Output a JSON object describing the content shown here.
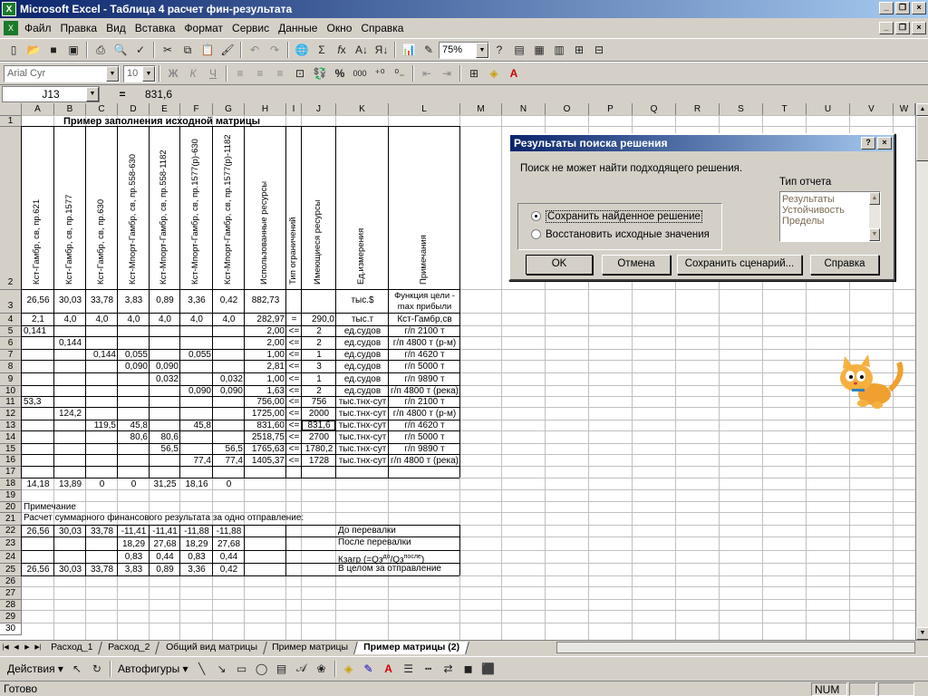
{
  "window": {
    "title": "Microsoft Excel - Таблица 4 расчет фин-результата"
  },
  "menu": [
    "Файл",
    "Правка",
    "Вид",
    "Вставка",
    "Формат",
    "Сервис",
    "Данные",
    "Окно",
    "Справка"
  ],
  "toolbar": {
    "zoom": "75%"
  },
  "format": {
    "font": "Arial Cyr",
    "size": "10"
  },
  "formula": {
    "cell": "J13",
    "eq": "=",
    "value": "831,6"
  },
  "columns": [
    "A",
    "B",
    "C",
    "D",
    "E",
    "F",
    "G",
    "H",
    "I",
    "J",
    "K",
    "L",
    "M",
    "N",
    "O",
    "P",
    "Q",
    "R",
    "S",
    "T",
    "U",
    "V",
    "W"
  ],
  "rows": [
    "1",
    "2",
    "3",
    "4",
    "5",
    "6",
    "7",
    "8",
    "9",
    "10",
    "11",
    "12",
    "13",
    "14",
    "15",
    "16",
    "17",
    "18",
    "19",
    "20",
    "21",
    "22",
    "23",
    "24",
    "25",
    "26",
    "27",
    "28",
    "29",
    "30"
  ],
  "sheet": {
    "title": "Пример заполнения исходной матрицы",
    "headers": [
      "Кст-Гамбр, св, пр.621",
      "Кст-Гамбр, св, пр.1577",
      "Кст-Гамбр, св, пр.630",
      "Кст-Мпорт-Гамбр, св, пр.558-630",
      "Кст-Мпорт-Гамбр, св, пр.558-1182",
      "Кст-Мпорт-Гамбр, св, пр.1577(р)-630",
      "Кст-Мпорт-Гамбр, св, пр.1577(р)-1182",
      "Использованные ресурсы",
      "Тип ограничений",
      "Имеющиеся ресурсы",
      "Ед.измерения",
      "Примечания"
    ],
    "r3": [
      "26,56",
      "30,03",
      "33,78",
      "3,83",
      "0,89",
      "3,36",
      "0,42",
      "882,73",
      "",
      "",
      "тыс.$",
      "Функция цели - max прибыли"
    ],
    "r4": [
      "2,1",
      "4,0",
      "4,0",
      "4,0",
      "4,0",
      "4,0",
      "4,0",
      "282,97",
      "=",
      "290,0",
      "тыс.т",
      "Кст-Гамбр,св"
    ],
    "r5": [
      "0,141",
      "",
      "",
      "",
      "",
      "",
      "",
      "2,00",
      "<=",
      "2",
      "ед.судов",
      "г/п 2100 т"
    ],
    "r6": [
      "",
      "0,144",
      "",
      "",
      "",
      "",
      "",
      "2,00",
      "<=",
      "2",
      "ед.судов",
      "г/п 4800 т (р-м)"
    ],
    "r7": [
      "",
      "",
      "0,144",
      "0,055",
      "",
      "0,055",
      "",
      "1,00",
      "<=",
      "1",
      "ед.судов",
      "г/п 4620 т"
    ],
    "r8": [
      "",
      "",
      "",
      "0,090",
      "0,090",
      "",
      "",
      "2,81",
      "<=",
      "3",
      "ед.судов",
      "г/п 5000 т"
    ],
    "r9": [
      "",
      "",
      "",
      "",
      "0,032",
      "",
      "0,032",
      "1,00",
      "<=",
      "1",
      "ед.судов",
      "г/п 9890 т"
    ],
    "r10": [
      "",
      "",
      "",
      "",
      "",
      "0,090",
      "0,090",
      "1,63",
      "<=",
      "2",
      "ед.судов",
      "г/п 4800 т (река)"
    ],
    "r11": [
      "53,3",
      "",
      "",
      "",
      "",
      "",
      "",
      "756,00",
      "<=",
      "756",
      "тыс.тнх-сут",
      "г/п 2100 т"
    ],
    "r12": [
      "",
      "124,2",
      "",
      "",
      "",
      "",
      "",
      "1725,00",
      "<=",
      "2000",
      "тыс.тнх-сут",
      "г/п 4800 т (р-м)"
    ],
    "r13": [
      "",
      "",
      "119,5",
      "45,8",
      "",
      "45,8",
      "",
      "831,60",
      "<=",
      "831,6",
      "тыс.тнх-сут",
      "г/п 4620 т"
    ],
    "r14": [
      "",
      "",
      "",
      "80,6",
      "80,6",
      "",
      "",
      "2518,75",
      "<=",
      "2700",
      "тыс.тнх-сут",
      "г/п 5000 т"
    ],
    "r15": [
      "",
      "",
      "",
      "",
      "56,5",
      "",
      "56,5",
      "1765,63",
      "<=",
      "1780,2",
      "тыс.тнх-сут",
      "г/п 9890 т"
    ],
    "r16": [
      "",
      "",
      "",
      "",
      "",
      "77,4",
      "77,4",
      "1405,37",
      "<=",
      "1728",
      "тыс.тнх-сут",
      "г/п 4800 т (река)"
    ],
    "r18": [
      "14,18",
      "13,89",
      "0",
      "0",
      "31,25",
      "18,16",
      "0"
    ],
    "r20": "Примечание",
    "r21": "Расчет суммарного финансового результата за одно отправление:",
    "r22": [
      "26,56",
      "30,03",
      "33,78",
      "-11,41",
      "-11,41",
      "-11,88",
      "-11,88"
    ],
    "r22k": "До перевалки",
    "r23": [
      "",
      "",
      "",
      "18,29",
      "27,68",
      "18,29",
      "27,68"
    ],
    "r23k": "После перевалки",
    "r24": [
      "",
      "",
      "",
      "0,83",
      "0,44",
      "0,83",
      "0,44"
    ],
    "r24k": "Кзагр (=Qз",
    "r24sup1": "до",
    "r24mid": "/Qз",
    "r24sup2": "после",
    "r24end": ")",
    "r25": [
      "26,56",
      "30,03",
      "33,78",
      "3,83",
      "0,89",
      "3,36",
      "0,42"
    ],
    "r25k": "В целом за отправление"
  },
  "tabs": [
    "Расход_1",
    "Расход_2",
    "Общий вид матрицы",
    "Пример матрицы",
    "Пример матрицы (2)"
  ],
  "drawing": {
    "actions": "Действия",
    "autoshapes": "Автофигуры"
  },
  "status": {
    "ready": "Готово",
    "num": "NUM"
  },
  "dialog": {
    "title": "Результаты поиска решения",
    "message": "Поиск не может найти подходящего решения.",
    "report_label": "Тип отчета",
    "reports": [
      "Результаты",
      "Устойчивость",
      "Пределы"
    ],
    "opt_keep": "Сохранить найденное решение",
    "opt_restore": "Восстановить исходные значения",
    "ok": "OK",
    "cancel": "Отмена",
    "save_scenario": "Сохранить сценарий...",
    "help": "Справка"
  }
}
